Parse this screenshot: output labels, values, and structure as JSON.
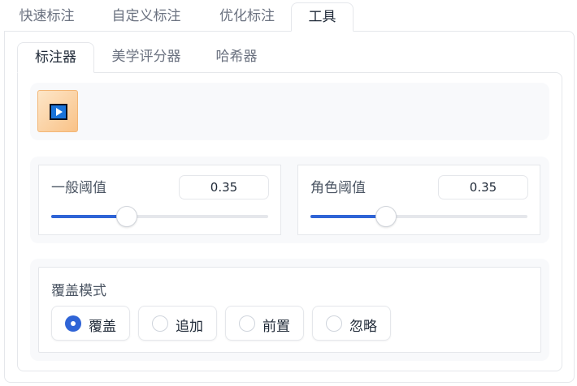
{
  "top_tabs": [
    {
      "label": "快速标注"
    },
    {
      "label": "自定义标注"
    },
    {
      "label": "优化标注"
    },
    {
      "label": "工具",
      "active": true
    }
  ],
  "sub_tabs": [
    {
      "label": "标注器",
      "active": true
    },
    {
      "label": "美学评分器"
    },
    {
      "label": "哈希器"
    }
  ],
  "run_button": {
    "icon": "play-icon"
  },
  "thresholds": {
    "general": {
      "label": "一般阈值",
      "value": "0.35",
      "fraction": 0.35
    },
    "character": {
      "label": "角色阈值",
      "value": "0.35",
      "fraction": 0.35
    }
  },
  "overwrite_mode": {
    "label": "覆盖模式",
    "options": [
      {
        "label": "覆盖",
        "checked": true
      },
      {
        "label": "追加"
      },
      {
        "label": "前置"
      },
      {
        "label": "忽略"
      }
    ]
  },
  "colors": {
    "accent": "#2f64d6",
    "play_bg": "#f9c287",
    "play_icon": "#1a73d9"
  }
}
